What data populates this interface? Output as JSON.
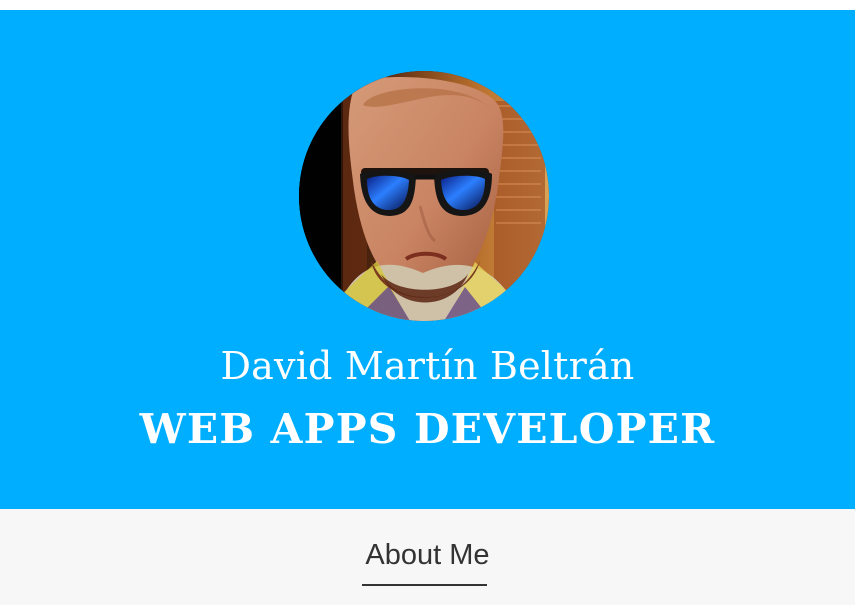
{
  "profile": {
    "name": "David Martín Beltrán",
    "title": "WEB APPS DEVELOPER",
    "avatar_alt": "profile-photo"
  },
  "sections": {
    "about_heading": "About Me"
  },
  "colors": {
    "hero_background": "#00aeff",
    "about_background": "#f7f7f7",
    "heading_text": "#333333",
    "hero_text": "#ffffff"
  }
}
